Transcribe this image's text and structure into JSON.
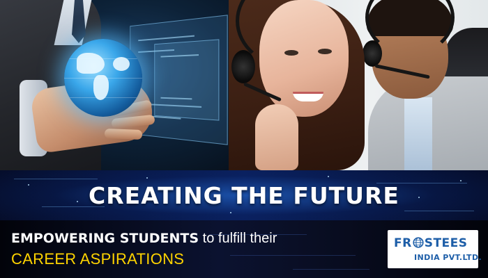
{
  "banner": {
    "headline": "CREATING THE FUTURE",
    "tagline": {
      "emphasis": "EMPOWERING STUDENTS",
      "rest": " to fulfill their",
      "highlight": "CAREER ASPIRATIONS"
    }
  },
  "logo": {
    "pre": "FR",
    "post": "STEES",
    "sub": "INDIA PVT.LTD.",
    "brand_color": "#1d5ea8"
  },
  "colors": {
    "headline": "#ffffff",
    "highlight": "#ffd400",
    "tech_band": "#0a1f5c"
  },
  "images": {
    "left_photo": "businessman-holding-globe",
    "right_photo": "call-center-agents-with-headsets"
  }
}
